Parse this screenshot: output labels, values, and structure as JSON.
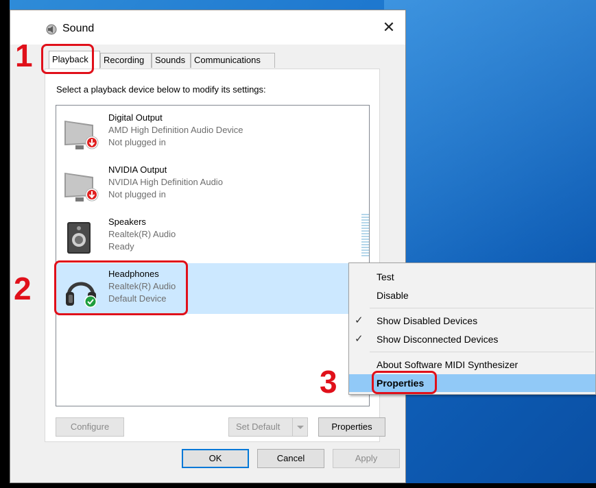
{
  "dialog": {
    "title": "Sound",
    "close_glyph": "✕",
    "tabs": [
      "Playback",
      "Recording",
      "Sounds",
      "Communications"
    ],
    "instruction": "Select a playback device below to modify its settings:",
    "devices": [
      {
        "name": "Digital Output",
        "desc": "AMD High Definition Audio Device",
        "status": "Not plugged in",
        "icon": "monitor-speaker-icon"
      },
      {
        "name": "NVIDIA Output",
        "desc": "NVIDIA High Definition Audio",
        "status": "Not plugged in",
        "icon": "monitor-speaker-icon"
      },
      {
        "name": "Speakers",
        "desc": "Realtek(R) Audio",
        "status": "Ready",
        "icon": "speaker-icon"
      },
      {
        "name": "Headphones",
        "desc": "Realtek(R) Audio",
        "status": "Default Device",
        "icon": "headphones-icon"
      }
    ],
    "buttons": {
      "configure": "Configure",
      "set_default": "Set Default",
      "properties": "Properties",
      "ok": "OK",
      "cancel": "Cancel",
      "apply": "Apply"
    }
  },
  "context_menu": {
    "items": [
      {
        "label": "Test",
        "checked": false
      },
      {
        "label": "Disable",
        "checked": false
      },
      {
        "label": "Show Disabled Devices",
        "checked": true
      },
      {
        "label": "Show Disconnected Devices",
        "checked": true
      },
      {
        "label": "About Software MIDI Synthesizer",
        "checked": false
      },
      {
        "label": "Properties",
        "checked": false
      }
    ],
    "check_glyph": "✓"
  },
  "annotations": [
    "1",
    "2",
    "3"
  ],
  "colors": {
    "annotation_red": "#e0101a",
    "selection_blue": "#cce8ff",
    "menu_highlight": "#91c9f7",
    "desktop_blue": "#1e78cf"
  }
}
